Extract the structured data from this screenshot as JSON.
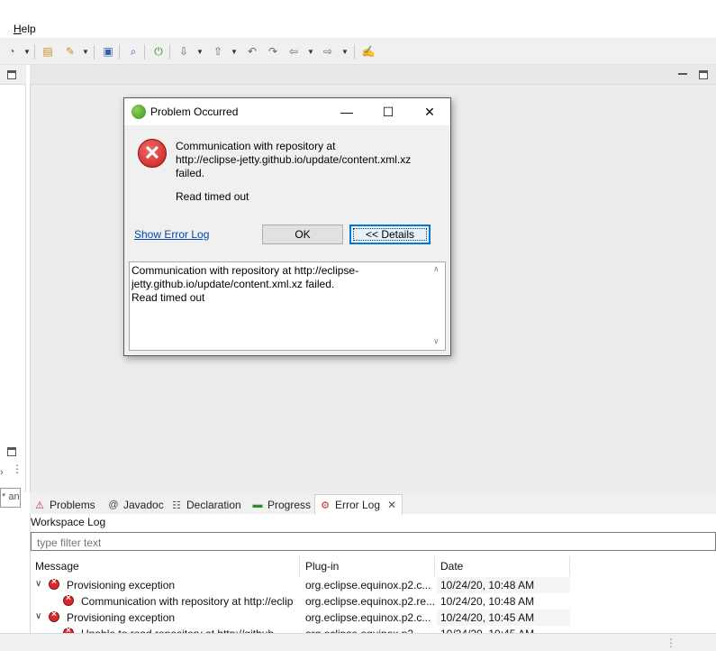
{
  "menu": {
    "items": [
      "Help"
    ]
  },
  "toolbar": {
    "icons": [
      "new-wizard-icon",
      "open-icon",
      "run-icon",
      "monitor-icon",
      "search-icon",
      "spring-boot-icon",
      "next-annotation-icon",
      "prev-annotation-icon",
      "last-edit-icon",
      "back-icon",
      "forward-icon",
      "pin-editor-icon"
    ]
  },
  "dialog": {
    "title": "Problem Occurred",
    "message": "Communication with repository at\nhttp://eclipse-jetty.github.io/update/content.xml.xz\nfailed.",
    "reason": "Read timed out",
    "show_error_log": "Show Error Log",
    "ok_label": "OK",
    "details_label": "<< Details",
    "details_text": "Communication with repository at http://eclipse-\njetty.github.io/update/content.xml.xz failed.\n  Read timed out"
  },
  "left": {
    "filter_text": "* an"
  },
  "bottom": {
    "tabs": [
      {
        "label": "Problems",
        "icon": "problems-icon"
      },
      {
        "label": "Javadoc",
        "icon": "javadoc-icon"
      },
      {
        "label": "Declaration",
        "icon": "declaration-icon"
      },
      {
        "label": "Progress",
        "icon": "progress-icon"
      },
      {
        "label": "Error Log",
        "icon": "error-log-icon"
      }
    ],
    "workspace_label": "Workspace Log",
    "filter_placeholder": "type filter text",
    "columns": [
      "Message",
      "Plug-in",
      "Date"
    ],
    "rows": [
      {
        "message": "Provisioning exception",
        "plugin": "org.eclipse.equinox.p2.c...",
        "date": "10/24/20, 10:48 AM"
      },
      {
        "message": "Communication with repository at http://eclip",
        "plugin": "org.eclipse.equinox.p2.re...",
        "date": "10/24/20, 10:48 AM"
      },
      {
        "message": "Provisioning exception",
        "plugin": "org.eclipse.equinox.p2.c...",
        "date": "10/24/20, 10:45 AM"
      },
      {
        "message": "Unable to read repository at http://github...",
        "plugin": "org.eclipse.equinox.p2...",
        "date": "10/24/20, 10:45 AM"
      }
    ]
  },
  "colors": {
    "accent": "#0078d7",
    "error": "#d72b2b",
    "link": "#0645ad"
  }
}
